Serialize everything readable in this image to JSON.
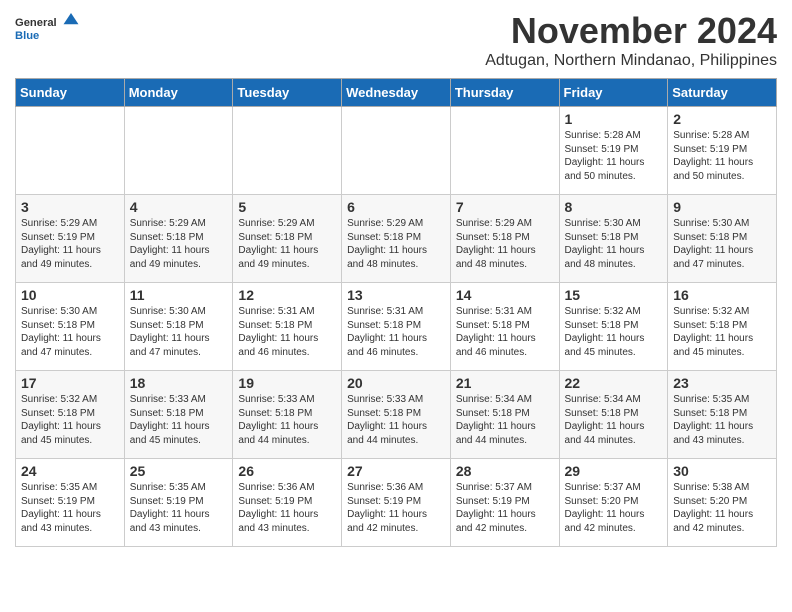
{
  "header": {
    "logo_general": "General",
    "logo_blue": "Blue",
    "month_year": "November 2024",
    "location": "Adtugan, Northern Mindanao, Philippines"
  },
  "weekdays": [
    "Sunday",
    "Monday",
    "Tuesday",
    "Wednesday",
    "Thursday",
    "Friday",
    "Saturday"
  ],
  "weeks": [
    [
      {
        "day": "",
        "info": ""
      },
      {
        "day": "",
        "info": ""
      },
      {
        "day": "",
        "info": ""
      },
      {
        "day": "",
        "info": ""
      },
      {
        "day": "",
        "info": ""
      },
      {
        "day": "1",
        "info": "Sunrise: 5:28 AM\nSunset: 5:19 PM\nDaylight: 11 hours\nand 50 minutes."
      },
      {
        "day": "2",
        "info": "Sunrise: 5:28 AM\nSunset: 5:19 PM\nDaylight: 11 hours\nand 50 minutes."
      }
    ],
    [
      {
        "day": "3",
        "info": "Sunrise: 5:29 AM\nSunset: 5:19 PM\nDaylight: 11 hours\nand 49 minutes."
      },
      {
        "day": "4",
        "info": "Sunrise: 5:29 AM\nSunset: 5:18 PM\nDaylight: 11 hours\nand 49 minutes."
      },
      {
        "day": "5",
        "info": "Sunrise: 5:29 AM\nSunset: 5:18 PM\nDaylight: 11 hours\nand 49 minutes."
      },
      {
        "day": "6",
        "info": "Sunrise: 5:29 AM\nSunset: 5:18 PM\nDaylight: 11 hours\nand 48 minutes."
      },
      {
        "day": "7",
        "info": "Sunrise: 5:29 AM\nSunset: 5:18 PM\nDaylight: 11 hours\nand 48 minutes."
      },
      {
        "day": "8",
        "info": "Sunrise: 5:30 AM\nSunset: 5:18 PM\nDaylight: 11 hours\nand 48 minutes."
      },
      {
        "day": "9",
        "info": "Sunrise: 5:30 AM\nSunset: 5:18 PM\nDaylight: 11 hours\nand 47 minutes."
      }
    ],
    [
      {
        "day": "10",
        "info": "Sunrise: 5:30 AM\nSunset: 5:18 PM\nDaylight: 11 hours\nand 47 minutes."
      },
      {
        "day": "11",
        "info": "Sunrise: 5:30 AM\nSunset: 5:18 PM\nDaylight: 11 hours\nand 47 minutes."
      },
      {
        "day": "12",
        "info": "Sunrise: 5:31 AM\nSunset: 5:18 PM\nDaylight: 11 hours\nand 46 minutes."
      },
      {
        "day": "13",
        "info": "Sunrise: 5:31 AM\nSunset: 5:18 PM\nDaylight: 11 hours\nand 46 minutes."
      },
      {
        "day": "14",
        "info": "Sunrise: 5:31 AM\nSunset: 5:18 PM\nDaylight: 11 hours\nand 46 minutes."
      },
      {
        "day": "15",
        "info": "Sunrise: 5:32 AM\nSunset: 5:18 PM\nDaylight: 11 hours\nand 45 minutes."
      },
      {
        "day": "16",
        "info": "Sunrise: 5:32 AM\nSunset: 5:18 PM\nDaylight: 11 hours\nand 45 minutes."
      }
    ],
    [
      {
        "day": "17",
        "info": "Sunrise: 5:32 AM\nSunset: 5:18 PM\nDaylight: 11 hours\nand 45 minutes."
      },
      {
        "day": "18",
        "info": "Sunrise: 5:33 AM\nSunset: 5:18 PM\nDaylight: 11 hours\nand 45 minutes."
      },
      {
        "day": "19",
        "info": "Sunrise: 5:33 AM\nSunset: 5:18 PM\nDaylight: 11 hours\nand 44 minutes."
      },
      {
        "day": "20",
        "info": "Sunrise: 5:33 AM\nSunset: 5:18 PM\nDaylight: 11 hours\nand 44 minutes."
      },
      {
        "day": "21",
        "info": "Sunrise: 5:34 AM\nSunset: 5:18 PM\nDaylight: 11 hours\nand 44 minutes."
      },
      {
        "day": "22",
        "info": "Sunrise: 5:34 AM\nSunset: 5:18 PM\nDaylight: 11 hours\nand 44 minutes."
      },
      {
        "day": "23",
        "info": "Sunrise: 5:35 AM\nSunset: 5:18 PM\nDaylight: 11 hours\nand 43 minutes."
      }
    ],
    [
      {
        "day": "24",
        "info": "Sunrise: 5:35 AM\nSunset: 5:19 PM\nDaylight: 11 hours\nand 43 minutes."
      },
      {
        "day": "25",
        "info": "Sunrise: 5:35 AM\nSunset: 5:19 PM\nDaylight: 11 hours\nand 43 minutes."
      },
      {
        "day": "26",
        "info": "Sunrise: 5:36 AM\nSunset: 5:19 PM\nDaylight: 11 hours\nand 43 minutes."
      },
      {
        "day": "27",
        "info": "Sunrise: 5:36 AM\nSunset: 5:19 PM\nDaylight: 11 hours\nand 42 minutes."
      },
      {
        "day": "28",
        "info": "Sunrise: 5:37 AM\nSunset: 5:19 PM\nDaylight: 11 hours\nand 42 minutes."
      },
      {
        "day": "29",
        "info": "Sunrise: 5:37 AM\nSunset: 5:20 PM\nDaylight: 11 hours\nand 42 minutes."
      },
      {
        "day": "30",
        "info": "Sunrise: 5:38 AM\nSunset: 5:20 PM\nDaylight: 11 hours\nand 42 minutes."
      }
    ]
  ]
}
